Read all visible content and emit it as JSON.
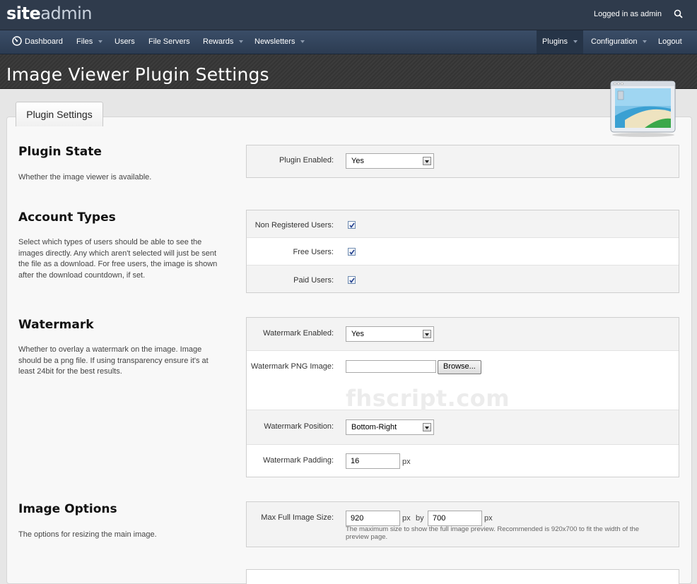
{
  "header": {
    "logo_bold": "site",
    "logo_light": "admin",
    "logged_in": "Logged in as admin"
  },
  "nav": {
    "dashboard": "Dashboard",
    "files": "Files",
    "users": "Users",
    "file_servers": "File Servers",
    "rewards": "Rewards",
    "newsletters": "Newsletters",
    "plugins": "Plugins",
    "configuration": "Configuration",
    "logout": "Logout"
  },
  "page": {
    "title": "Image Viewer Plugin Settings",
    "tab": "Plugin Settings"
  },
  "sections": {
    "plugin_state": {
      "title": "Plugin State",
      "desc": "Whether the image viewer is available.",
      "enabled_label": "Plugin Enabled:",
      "enabled_value": "Yes"
    },
    "account_types": {
      "title": "Account Types",
      "desc": "Select which types of users should be able to see the images directly. Any which aren't selected will just be sent the file as a download. For free users, the image is shown after the download countdown, if set.",
      "non_registered_label": "Non Registered Users:",
      "free_label": "Free Users:",
      "paid_label": "Paid Users:"
    },
    "watermark": {
      "title": "Watermark",
      "desc": "Whether to overlay a watermark on the image. Image should be a png file. If using transparency ensure it's at least 24bit for the best results.",
      "enabled_label": "Watermark Enabled:",
      "enabled_value": "Yes",
      "png_label": "Watermark PNG Image:",
      "browse": "Browse...",
      "preview_text": "fhscript.com",
      "position_label": "Watermark Position:",
      "position_value": "Bottom-Right",
      "padding_label": "Watermark Padding:",
      "padding_value": "16",
      "padding_unit": "px"
    },
    "image_options": {
      "title": "Image Options",
      "desc": "The options for resizing the main image.",
      "max_label": "Max Full Image Size:",
      "width": "920",
      "width_unit": "px",
      "by": "by",
      "height": "700",
      "height_unit": "px",
      "hint": "The maximum size to show the full image preview. Recommended is 920x700 to fit the width of the preview page."
    }
  }
}
